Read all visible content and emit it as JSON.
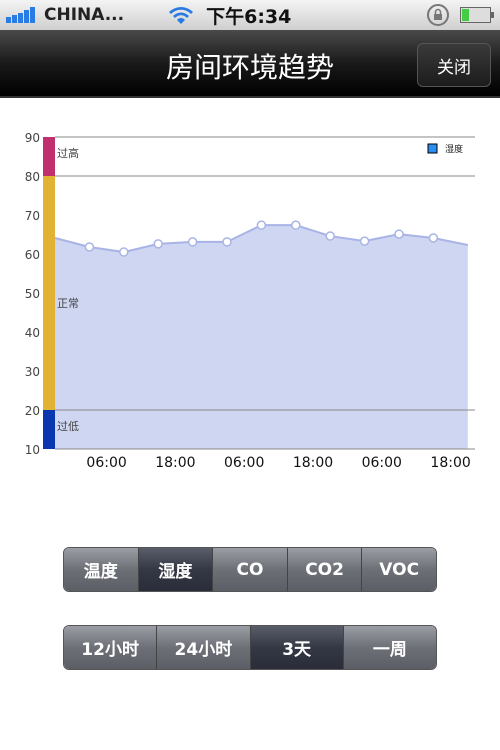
{
  "status": {
    "carrier": "CHINA...",
    "time": "下午6:34"
  },
  "nav": {
    "title": "房间环境趋势",
    "close": "关闭"
  },
  "chart_data": {
    "type": "area",
    "ylim": [
      10,
      90
    ],
    "yticks": [
      90,
      80,
      70,
      60,
      50,
      40,
      30,
      20,
      10
    ],
    "xtick_labels": [
      "06:00",
      "18:00",
      "06:00",
      "18:00",
      "06:00",
      "18:00"
    ],
    "legend": {
      "label": "湿度",
      "color": "#2a8ff0",
      "position": "top-right"
    },
    "zones": [
      {
        "label": "过高",
        "from": 80,
        "to": 90,
        "color": "#c0306e"
      },
      {
        "label": "正常",
        "from": 20,
        "to": 80,
        "color": "#e2b235"
      },
      {
        "label": "过低",
        "from": 10,
        "to": 20,
        "color": "#0a36b0"
      }
    ],
    "series": [
      {
        "name": "湿度",
        "values": [
          64.1,
          61.8,
          60.5,
          62.6,
          63.1,
          63.1,
          67.4,
          67.4,
          64.6,
          63.3,
          65.1,
          64.1,
          62.3
        ],
        "fill": "#cfd6f2",
        "line": "#a9b4e6"
      }
    ]
  },
  "sensor_tabs": [
    {
      "label": "温度"
    },
    {
      "label": "湿度",
      "selected": true
    },
    {
      "label": "CO"
    },
    {
      "label": "CO2"
    },
    {
      "label": "VOC"
    }
  ],
  "range_tabs": [
    {
      "label": "12小时"
    },
    {
      "label": "24小时"
    },
    {
      "label": "3天",
      "selected": true
    },
    {
      "label": "一周"
    }
  ]
}
